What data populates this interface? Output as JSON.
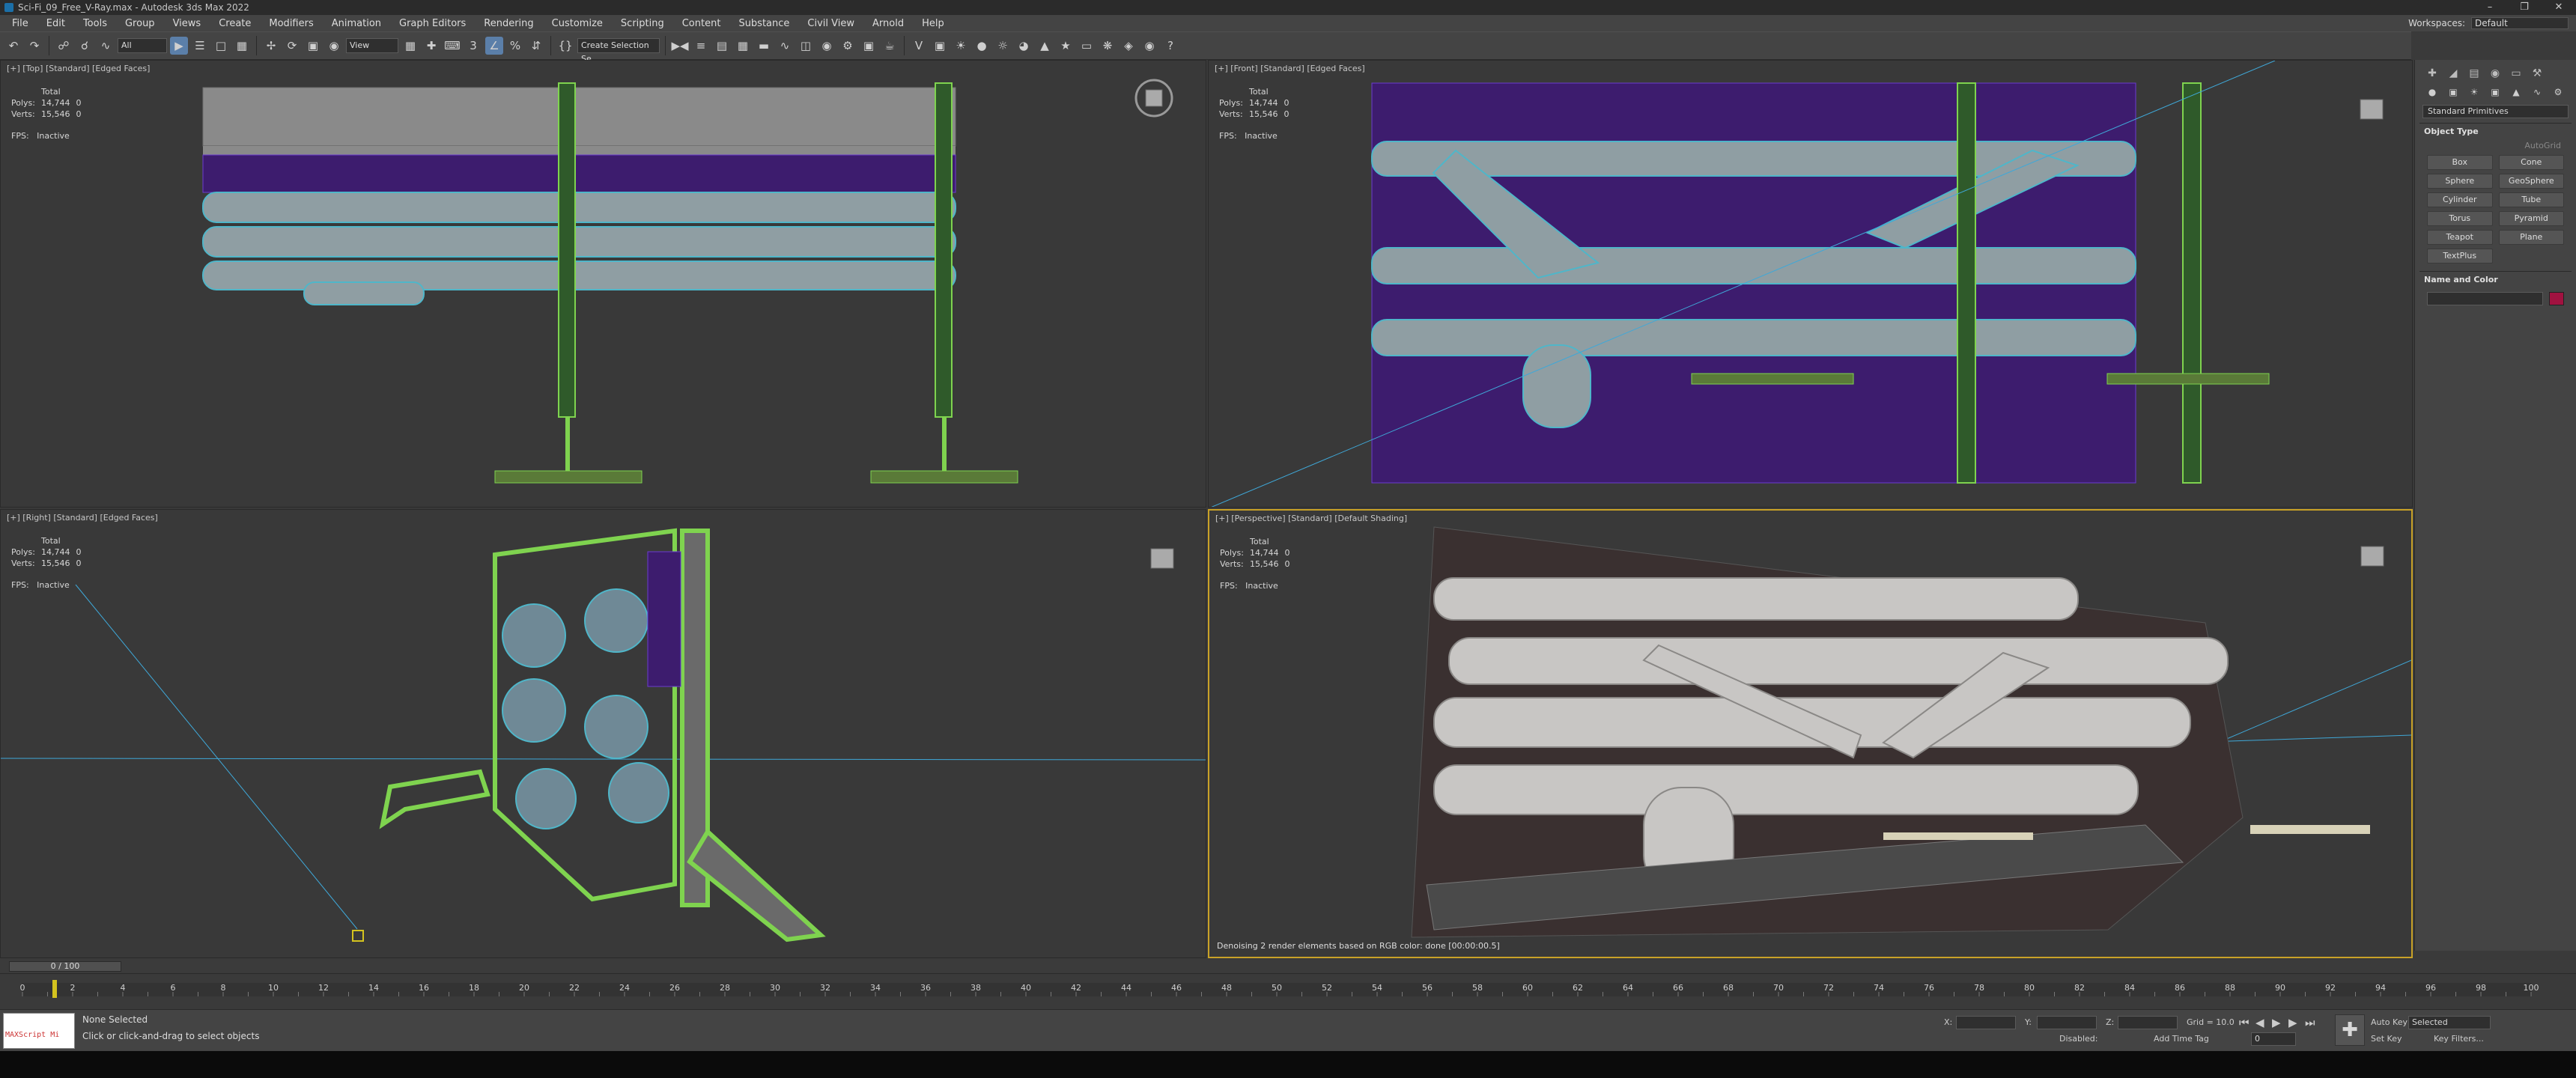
{
  "title_bar": {
    "title": "Sci-Fi_09_Free_V-Ray.max - Autodesk 3ds Max 2022"
  },
  "menu": [
    "File",
    "Edit",
    "Tools",
    "Group",
    "Views",
    "Create",
    "Modifiers",
    "Animation",
    "Graph Editors",
    "Rendering",
    "Customize",
    "Scripting",
    "Content",
    "Substance",
    "Civil View",
    "Arnold",
    "Help"
  ],
  "workspace": {
    "label": "Workspaces:",
    "value": "Default"
  },
  "toolbar": {
    "filter_value": "All",
    "refcoord_value": "View",
    "selection_set_placeholder": "Create Selection Se"
  },
  "viewports": [
    {
      "label": "[+] [Top] [Standard] [Edged Faces]",
      "stats_title": "Total",
      "polys_label": "Polys:",
      "polys": "14,744",
      "polys_sel": "0",
      "verts_label": "Verts:",
      "verts": "15,546",
      "verts_sel": "0",
      "fps_label": "FPS:",
      "fps": "Inactive"
    },
    {
      "label": "[+] [Front] [Standard] [Edged Faces]",
      "stats_title": "Total",
      "polys_label": "Polys:",
      "polys": "14,744",
      "polys_sel": "0",
      "verts_label": "Verts:",
      "verts": "15,546",
      "verts_sel": "0",
      "fps_label": "FPS:",
      "fps": "Inactive"
    },
    {
      "label": "[+] [Right] [Standard] [Edged Faces]",
      "stats_title": "Total",
      "polys_label": "Polys:",
      "polys": "14,744",
      "polys_sel": "0",
      "verts_label": "Verts:",
      "verts": "15,546",
      "verts_sel": "0",
      "fps_label": "FPS:",
      "fps": "Inactive"
    },
    {
      "label": "[+] [Perspective] [Standard] [Default Shading]",
      "stats_title": "Total",
      "polys_label": "Polys:",
      "polys": "14,744",
      "polys_sel": "0",
      "verts_label": "Verts:",
      "verts": "15,546",
      "verts_sel": "0",
      "fps_label": "FPS:",
      "fps": "Inactive",
      "message": "Denoising 2 render elements based on RGB color: done [00:00:00.5]"
    }
  ],
  "command_panel": {
    "category": "Standard Primitives",
    "object_type_header": "Object Type",
    "autogrid": "AutoGrid",
    "primitives": [
      "Box",
      "Cone",
      "Sphere",
      "GeoSphere",
      "Cylinder",
      "Tube",
      "Torus",
      "Pyramid",
      "Teapot",
      "Plane",
      "TextPlus"
    ],
    "name_color_header": "Name and Color",
    "object_color": "#a11240"
  },
  "timeline": {
    "slider_text": "0 / 100",
    "ticks": [
      "0",
      "2",
      "4",
      "6",
      "8",
      "10",
      "12",
      "14",
      "16",
      "18",
      "20",
      "22",
      "24",
      "26",
      "28",
      "30",
      "32",
      "34",
      "36",
      "38",
      "40",
      "42",
      "44",
      "46",
      "48",
      "50",
      "52",
      "54",
      "56",
      "58",
      "60",
      "62",
      "64",
      "66",
      "68",
      "70",
      "72",
      "74",
      "76",
      "78",
      "80",
      "82",
      "84",
      "86",
      "88",
      "90",
      "92",
      "94",
      "96",
      "98",
      "100"
    ]
  },
  "status": {
    "maxscript_label": "MAXScript Mi",
    "selection": "None Selected",
    "prompt": "Click or click-and-drag to select objects",
    "x_label": "X:",
    "y_label": "Y:",
    "z_label": "Z:",
    "grid": "Grid = 10.0",
    "disabled_label": "Disabled:",
    "add_time_tag": "Add Time Tag",
    "auto_key": "Auto Key",
    "set_key": "Set Key",
    "key_mode_value": "Selected",
    "key_filters": "Key Filters...",
    "frame_value": "0"
  }
}
